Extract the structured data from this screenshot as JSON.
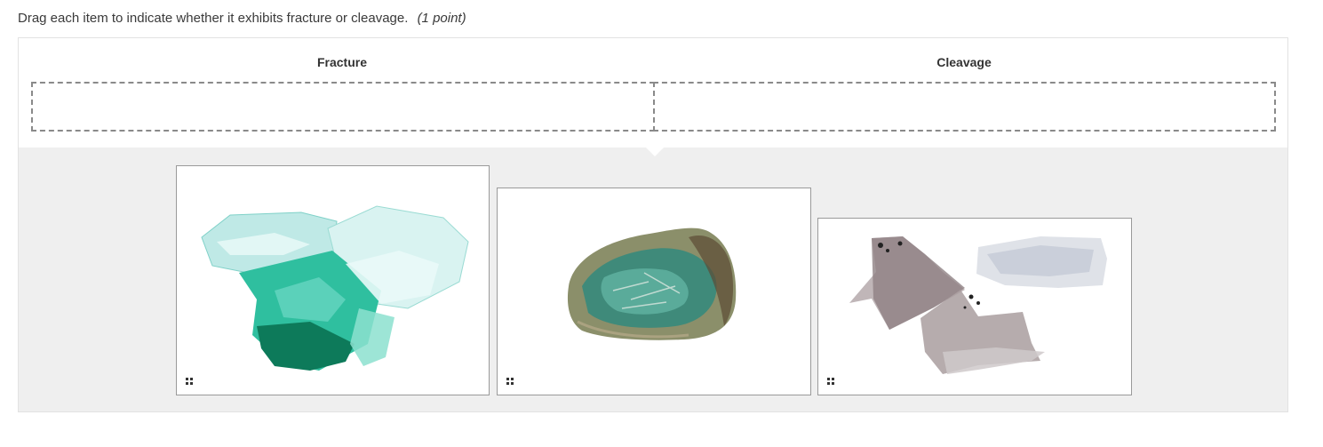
{
  "question": {
    "text": "Drag each item to indicate whether it exhibits fracture or cleavage.",
    "points": "(1 point)"
  },
  "categories": [
    {
      "label": "Fracture"
    },
    {
      "label": "Cleavage"
    }
  ],
  "items": [
    {
      "icon": "drag-handle-icon",
      "image": "aqua-quartz-crystal-cluster"
    },
    {
      "icon": "drag-handle-icon",
      "image": "green-rough-rock"
    },
    {
      "icon": "drag-handle-icon",
      "image": "mica-sheets"
    }
  ]
}
